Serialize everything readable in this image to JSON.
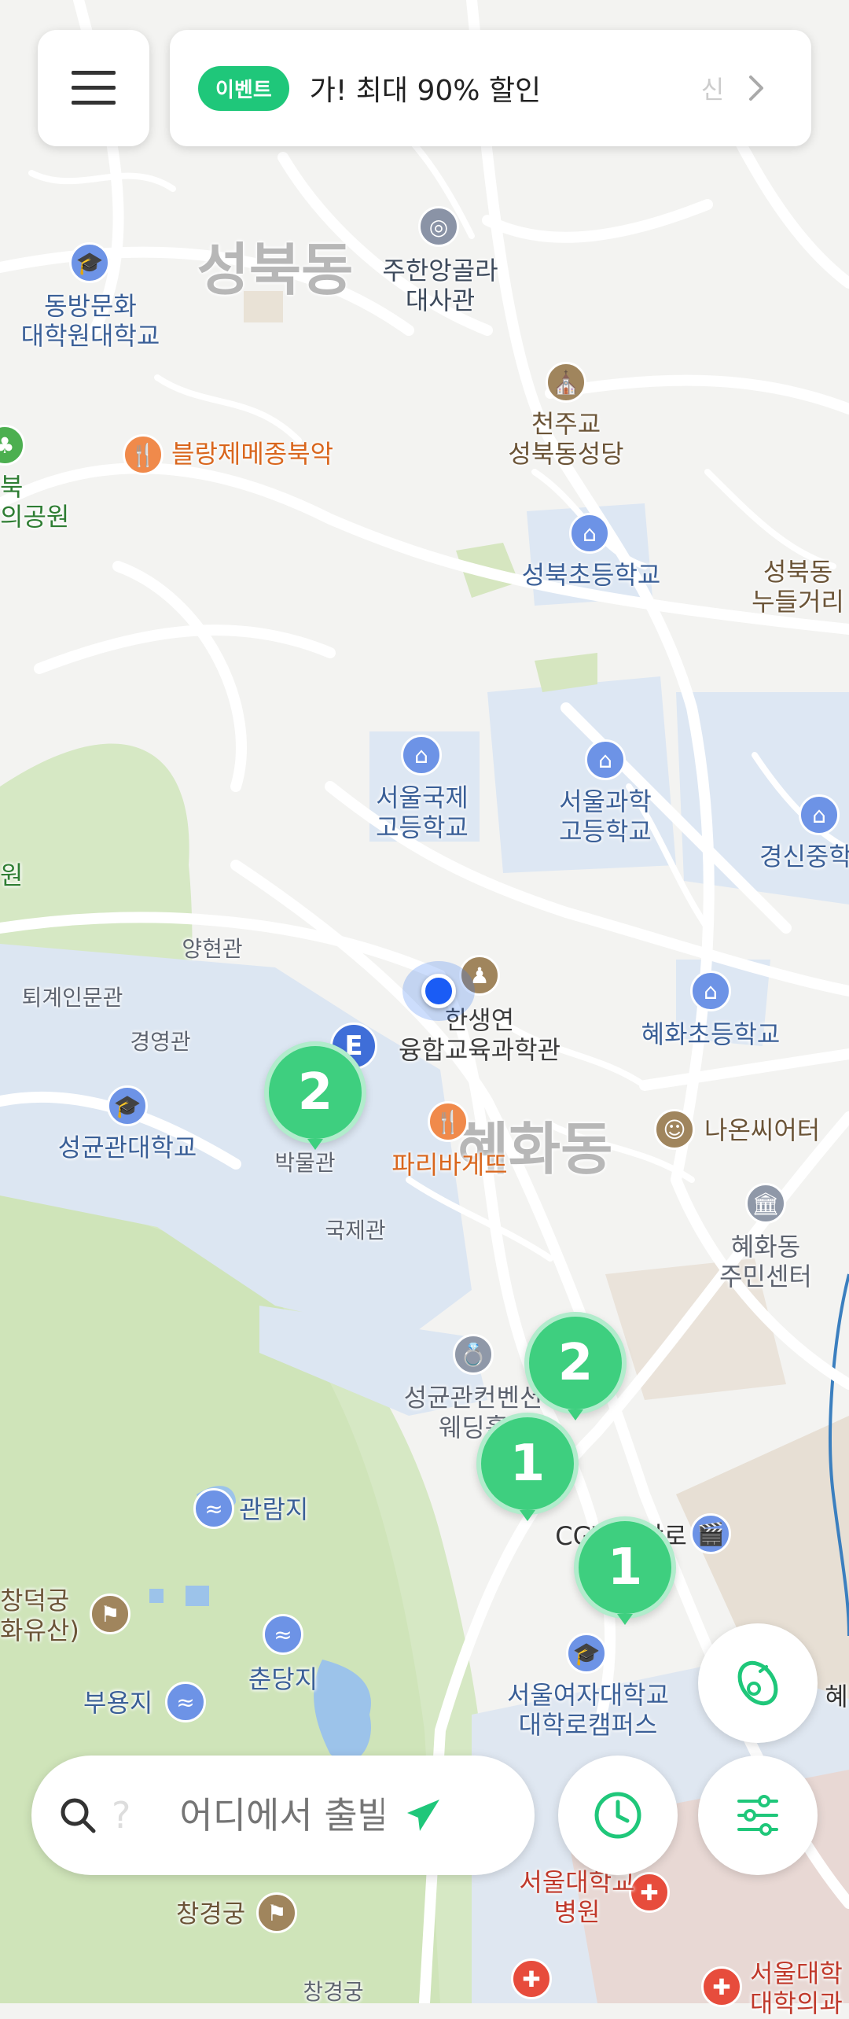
{
  "menu": {
    "icon": "hamburger-menu-icon"
  },
  "event_banner": {
    "badge": "이벤트",
    "text": "가! 최대 90% 할인",
    "trailing_text": "신",
    "chevron": "chevron-right-icon"
  },
  "map": {
    "area_labels": [
      "성북동",
      "혜화동"
    ],
    "places": {
      "embassy": "주한앙골라\n대사관",
      "dongbang": "동방문화\n대학원대학교",
      "catholic": "천주교\n성북동성당",
      "bakery1": "블랑제메종북악",
      "park": "북\n의공원",
      "seongbuk_elem": "성북초등학교",
      "seongbuk_street": "성북동\n누들거리",
      "seoul_intl": "서울국제\n고등학교",
      "seoul_sci": "서울과학\n고등학교",
      "gyeongsin": "경신중학",
      "won": "원",
      "yanghyeon": "양현관",
      "toegye": "퇴계인문관",
      "gyeongyeong": "경영관",
      "hansaeng": "한생연\n융합교육과학관",
      "hyehwa_elem": "혜화초등학교",
      "skku": "성균관대학교",
      "museum": "박물관",
      "paris": "파리바게뜨",
      "nanshi": "나온씨어터",
      "gukje": "국제관",
      "community": "혜화동\n주민센터",
      "convention": "성균관컨벤션\n웨딩홀",
      "cgv": "CGV 대학로",
      "gwanramji": "관람지",
      "changdeok": "창덕궁\n화유산)",
      "chundangji": "춘당지",
      "buyongji": "부용지",
      "swu": "서울여자대학교\n대학로캠퍼스",
      "hye_partial": "혜",
      "changgyeong": "창경궁",
      "snuh": "서울대학교\n병원",
      "snuh2": "서울대학\n대학의과",
      "changgyeong_bottom": "창경궁"
    },
    "clusters": [
      "2",
      "2",
      "1",
      "1"
    ],
    "e_marker": "E",
    "current_location": "current-location-dot"
  },
  "bottom_bar": {
    "search_placeholder": "어디에서 출발?",
    "search_prefix": "?",
    "search_icon": "search-icon",
    "navigate_icon": "navigation-arrow-icon",
    "history_icon": "clock-icon",
    "filter_icon": "sliders-icon",
    "scooter_icon": "scooter-icon"
  },
  "colors": {
    "accent": "#1fc77a",
    "cluster": "#3ecf7f",
    "location": "#1a5cf5"
  }
}
